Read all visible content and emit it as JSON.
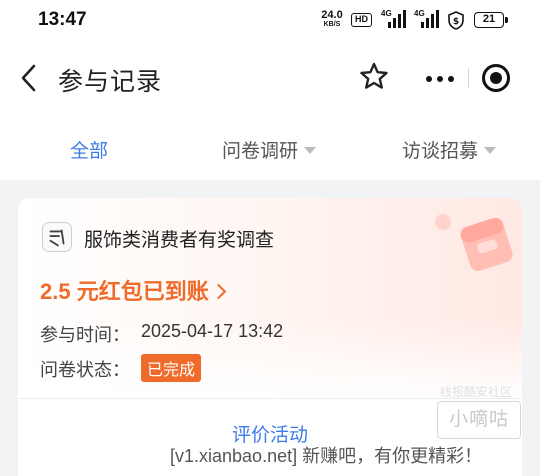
{
  "status_bar": {
    "time": "13:47",
    "net_speed_value": "24.0",
    "net_speed_unit": "KB/S",
    "hd_label": "HD",
    "signal1_label": "4G",
    "signal2_label": "4G",
    "battery": "21"
  },
  "nav": {
    "title": "参与记录"
  },
  "tabs": [
    {
      "label": "全部",
      "active": true
    },
    {
      "label": "问卷调研",
      "active": false
    },
    {
      "label": "访谈招募",
      "active": false
    }
  ],
  "record": {
    "survey_name": "服饰类消费者有奖调查",
    "reward_text": "2.5 元红包已到账",
    "time_label": "参与时间：",
    "time_value": "2025-04-17 13:42",
    "status_label": "问卷状态：",
    "status_value": "已完成",
    "action_label": "评价活动"
  },
  "watermark": {
    "label": "线报酷安社区",
    "box_text": "小嘀咕",
    "bar_text": "[v1.xianbao.net] 新赚吧，有你更精彩！"
  },
  "colors": {
    "accent_blue": "#3d7bea",
    "accent_orange": "#f06b2a"
  }
}
